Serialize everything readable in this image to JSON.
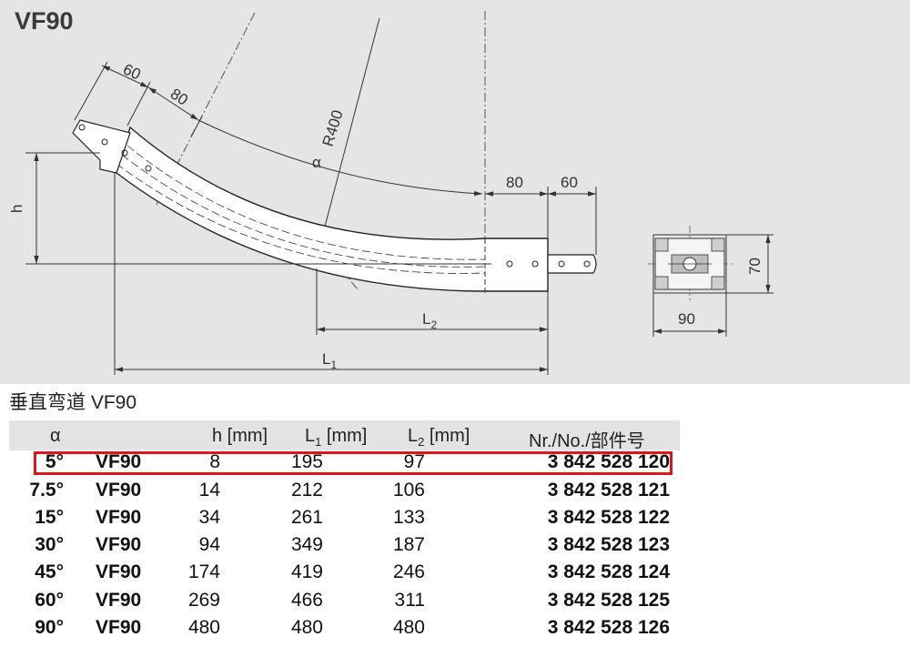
{
  "title": "VF90",
  "drawing": {
    "dims": {
      "d60a": "60",
      "d80a": "80",
      "alpha": "α",
      "radius": "R400",
      "d80b": "80",
      "d60b": "60",
      "h": "h",
      "L2": "L",
      "L2sub": "2",
      "L1": "L",
      "L1sub": "1",
      "w90": "90",
      "h70": "70"
    }
  },
  "table": {
    "caption": "垂直弯道 VF90",
    "headers": {
      "alpha": "α",
      "h": "h [mm]",
      "L1": "L",
      "L1sub": "1",
      "L1unit": " [mm]",
      "L2": "L",
      "L2sub": "2",
      "L2unit": " [mm]",
      "nr": "Nr./No./部件号"
    },
    "rows": [
      {
        "alpha": "5°",
        "type": "VF90",
        "h": "8",
        "L1": "195",
        "L2": "97",
        "nr": "3 842 528 120"
      },
      {
        "alpha": "7.5°",
        "type": "VF90",
        "h": "14",
        "L1": "212",
        "L2": "106",
        "nr": "3 842 528 121"
      },
      {
        "alpha": "15°",
        "type": "VF90",
        "h": "34",
        "L1": "261",
        "L2": "133",
        "nr": "3 842 528 122"
      },
      {
        "alpha": "30°",
        "type": "VF90",
        "h": "94",
        "L1": "349",
        "L2": "187",
        "nr": "3 842 528 123"
      },
      {
        "alpha": "45°",
        "type": "VF90",
        "h": "174",
        "L1": "419",
        "L2": "246",
        "nr": "3 842 528 124"
      },
      {
        "alpha": "60°",
        "type": "VF90",
        "h": "269",
        "L1": "466",
        "L2": "311",
        "nr": "3 842 528 125"
      },
      {
        "alpha": "90°",
        "type": "VF90",
        "h": "480",
        "L1": "480",
        "L2": "480",
        "nr": "3 842 528 126"
      }
    ],
    "highlight_color": "#e0151b"
  }
}
